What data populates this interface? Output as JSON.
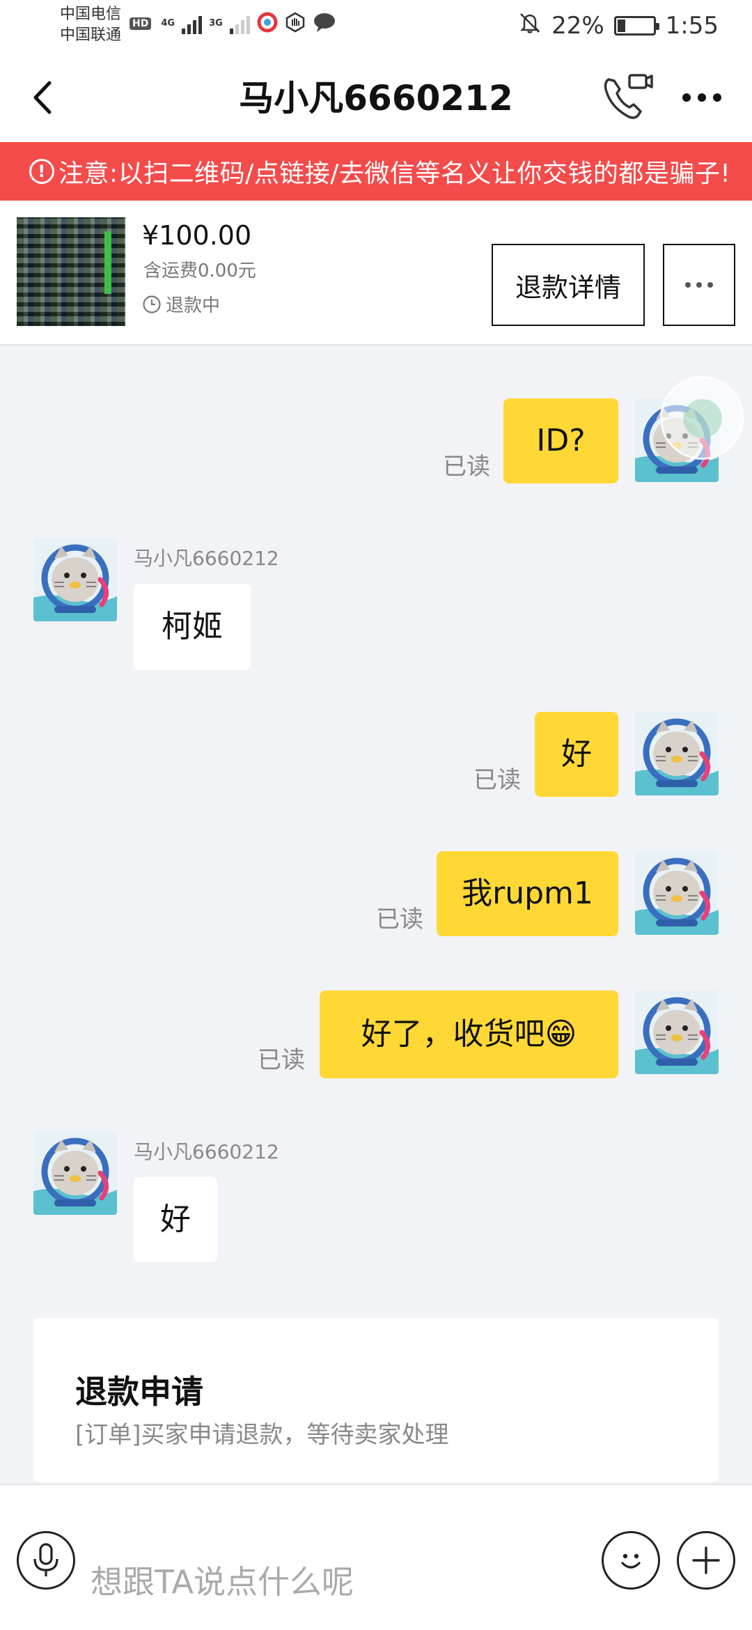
{
  "status_bar": {
    "carrier_1": "中国电信",
    "carrier_2": "中国联通",
    "hd": "HD",
    "net_1": "4G",
    "net_2": "3G",
    "battery": "22%",
    "battery_level": 0.22,
    "time": "1:55"
  },
  "header": {
    "title": "马小凡6660212"
  },
  "warning": {
    "text": "注意:以扫二维码/点链接/去微信等名义让你交钱的都是骗子!"
  },
  "product": {
    "price": "¥100.00",
    "shipping": "含运费0.00元",
    "status": "退款中",
    "refund_detail_button": "退款详情"
  },
  "chat": {
    "read_label": "已读",
    "messages": [
      {
        "from": "me",
        "text": "ID?"
      },
      {
        "from": "them",
        "sender": "马小凡6660212",
        "text": "柯姬"
      },
      {
        "from": "me",
        "text": "好"
      },
      {
        "from": "me",
        "text": "我rupm1"
      },
      {
        "from": "me",
        "text": "好了，收货吧😁"
      },
      {
        "from": "them",
        "sender": "马小凡6660212",
        "text": "好"
      }
    ]
  },
  "refund_card": {
    "title": "退款申请",
    "description": "[订单]买家申请退款，等待卖家处理"
  },
  "input": {
    "placeholder": "想跟TA说点什么呢"
  },
  "colors": {
    "warning_bg": "#f44b4b",
    "my_bubble": "#ffd835",
    "their_bubble": "#ffffff",
    "background": "#f2f3f7"
  }
}
